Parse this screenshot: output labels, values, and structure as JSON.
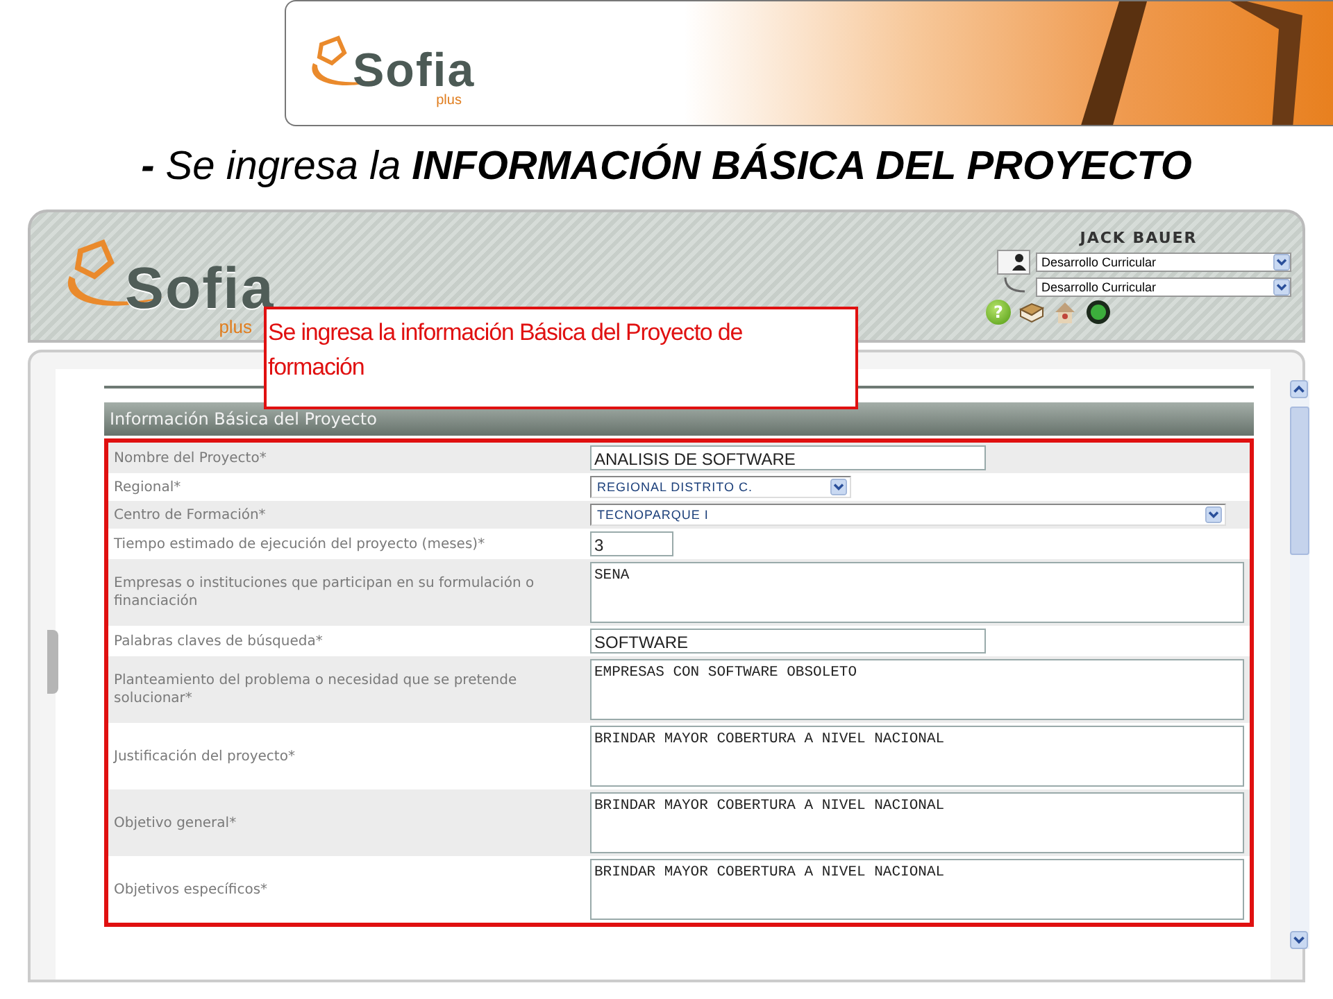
{
  "banner": {
    "logo": {
      "name": "Sofia",
      "suffix": "plus"
    }
  },
  "slide_title": "**-** Se ingresa la **INFORMACIÓN BÁSICA DEL PROYECTO**",
  "app": {
    "logo": {
      "name": "Sofia",
      "suffix": "plus"
    },
    "user": {
      "name": "JACK BAUER",
      "selects": [
        "Desarrollo Curricular",
        "Desarrollo Curricular"
      ]
    },
    "toolbar": [
      {
        "kind": "help",
        "glyph": "?"
      },
      {
        "kind": "book"
      },
      {
        "kind": "home"
      },
      {
        "kind": "exit"
      }
    ],
    "callout": "Se ingresa la información Básica del Proyecto de formación",
    "section_title": "Información Básica del Proyecto",
    "fields": [
      {
        "label": "Nombre del Proyecto*",
        "kind": "text",
        "value": "ANALISIS DE SOFTWARE"
      },
      {
        "label": "Regional*",
        "kind": "select",
        "value": "REGIONAL DISTRITO C."
      },
      {
        "label": "Centro de Formación*",
        "kind": "select-wide",
        "value": "TECNOPARQUE I"
      },
      {
        "label": "Tiempo estimado de ejecución del proyecto (meses)*",
        "kind": "number",
        "value": "3"
      },
      {
        "label": "Empresas o instituciones que participan en su formulación o financiación",
        "kind": "textarea",
        "value": "SENA"
      },
      {
        "label": "Palabras claves de búsqueda*",
        "kind": "text",
        "value": "SOFTWARE"
      },
      {
        "label": "Planteamiento del problema o necesidad que se pretende solucionar*",
        "kind": "textarea",
        "value": "EMPRESAS CON SOFTWARE OBSOLETO"
      },
      {
        "label": "Justificación del proyecto*",
        "kind": "textarea",
        "value": "BRINDAR MAYOR COBERTURA A NIVEL NACIONAL"
      },
      {
        "label": "Objetivo general*",
        "kind": "textarea",
        "value": "BRINDAR MAYOR COBERTURA A NIVEL NACIONAL"
      },
      {
        "label": "Objetivos específicos*",
        "kind": "textarea",
        "value": "BRINDAR MAYOR COBERTURA A NIVEL NACIONAL"
      }
    ]
  }
}
